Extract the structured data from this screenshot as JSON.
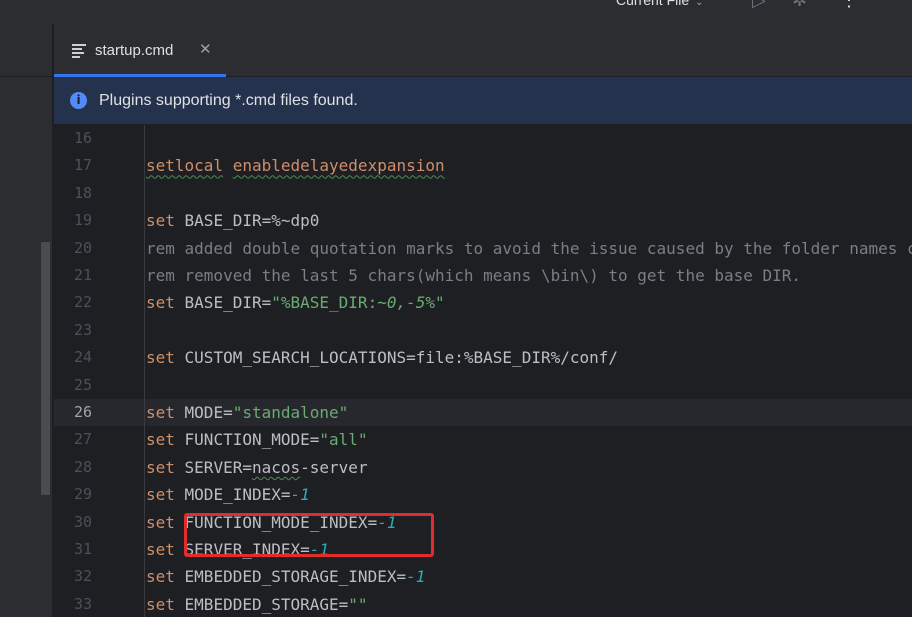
{
  "toolbar": {
    "run_config_label": "Current File",
    "run_config_icon": "chevron-down-icon",
    "run_icon": "play-icon",
    "debug_icon": "bug-icon",
    "more_icon": "more-vertical-icon"
  },
  "tabs": [
    {
      "label": "startup.cmd",
      "icon": "file-icon",
      "close_icon": "close-icon",
      "active": true
    }
  ],
  "banner": {
    "icon": "info-icon",
    "text": "Plugins supporting *.cmd files found."
  },
  "editor": {
    "active_line": "26",
    "lines": [
      {
        "num": "16",
        "tokens": []
      },
      {
        "num": "17",
        "tokens": [
          {
            "t": "setlocal",
            "c": "kw typo"
          },
          {
            "t": " ",
            "c": ""
          },
          {
            "t": "enabledelayedexpansion",
            "c": "kw typo"
          }
        ]
      },
      {
        "num": "18",
        "tokens": []
      },
      {
        "num": "19",
        "tokens": [
          {
            "t": "set",
            "c": "kw"
          },
          {
            "t": " BASE_DIR=%~dp0",
            "c": ""
          }
        ]
      },
      {
        "num": "20",
        "tokens": [
          {
            "t": "rem added double quotation marks to avoid the issue caused by the folder names containing spac",
            "c": "cmt"
          }
        ]
      },
      {
        "num": "21",
        "tokens": [
          {
            "t": "rem removed the last 5 chars(which means \\bin\\) to get the base DIR.",
            "c": "cmt"
          }
        ]
      },
      {
        "num": "22",
        "tokens": [
          {
            "t": "set",
            "c": "kw"
          },
          {
            "t": " BASE_DIR=",
            "c": ""
          },
          {
            "t": "\"%BASE_DIR:",
            "c": "str"
          },
          {
            "t": "~0,-5",
            "c": "str-i"
          },
          {
            "t": "%\"",
            "c": "str"
          }
        ]
      },
      {
        "num": "23",
        "tokens": []
      },
      {
        "num": "24",
        "tokens": [
          {
            "t": "set",
            "c": "kw"
          },
          {
            "t": " CUSTOM_SEARCH_LOCATIONS=file:%BASE_DIR%/conf/",
            "c": ""
          }
        ]
      },
      {
        "num": "25",
        "tokens": []
      },
      {
        "num": "26",
        "tokens": [
          {
            "t": "set",
            "c": "kw"
          },
          {
            "t": " MODE=",
            "c": ""
          },
          {
            "t": "\"standalone\"",
            "c": "str"
          }
        ]
      },
      {
        "num": "27",
        "tokens": [
          {
            "t": "set",
            "c": "kw"
          },
          {
            "t": " FUNCTION_MODE=",
            "c": ""
          },
          {
            "t": "\"all\"",
            "c": "str"
          }
        ]
      },
      {
        "num": "28",
        "tokens": [
          {
            "t": "set",
            "c": "kw"
          },
          {
            "t": " SERVER=",
            "c": ""
          },
          {
            "t": "nacos",
            "c": "typo"
          },
          {
            "t": "-server",
            "c": ""
          }
        ]
      },
      {
        "num": "29",
        "tokens": [
          {
            "t": "set",
            "c": "kw"
          },
          {
            "t": " MODE_INDEX=",
            "c": ""
          },
          {
            "t": "-1",
            "c": "num"
          }
        ]
      },
      {
        "num": "30",
        "tokens": [
          {
            "t": "set",
            "c": "kw"
          },
          {
            "t": " FUNCTION_MODE_INDEX=",
            "c": ""
          },
          {
            "t": "-1",
            "c": "num"
          }
        ]
      },
      {
        "num": "31",
        "tokens": [
          {
            "t": "set",
            "c": "kw"
          },
          {
            "t": " SERVER_INDEX=",
            "c": ""
          },
          {
            "t": "-1",
            "c": "num"
          }
        ]
      },
      {
        "num": "32",
        "tokens": [
          {
            "t": "set",
            "c": "kw"
          },
          {
            "t": " EMBEDDED_STORAGE_INDEX=",
            "c": ""
          },
          {
            "t": "-1",
            "c": "num"
          }
        ]
      },
      {
        "num": "33",
        "tokens": [
          {
            "t": "set",
            "c": "kw"
          },
          {
            "t": " EMBEDDED_STORAGE=",
            "c": ""
          },
          {
            "t": "\"\"",
            "c": "str"
          }
        ]
      }
    ]
  },
  "colors": {
    "accent": "#3574f0",
    "keyword": "#cf8e6d",
    "string": "#6aab73",
    "number": "#2aacb8",
    "comment": "#7a7e85",
    "highlight_box": "#e22b2b"
  }
}
